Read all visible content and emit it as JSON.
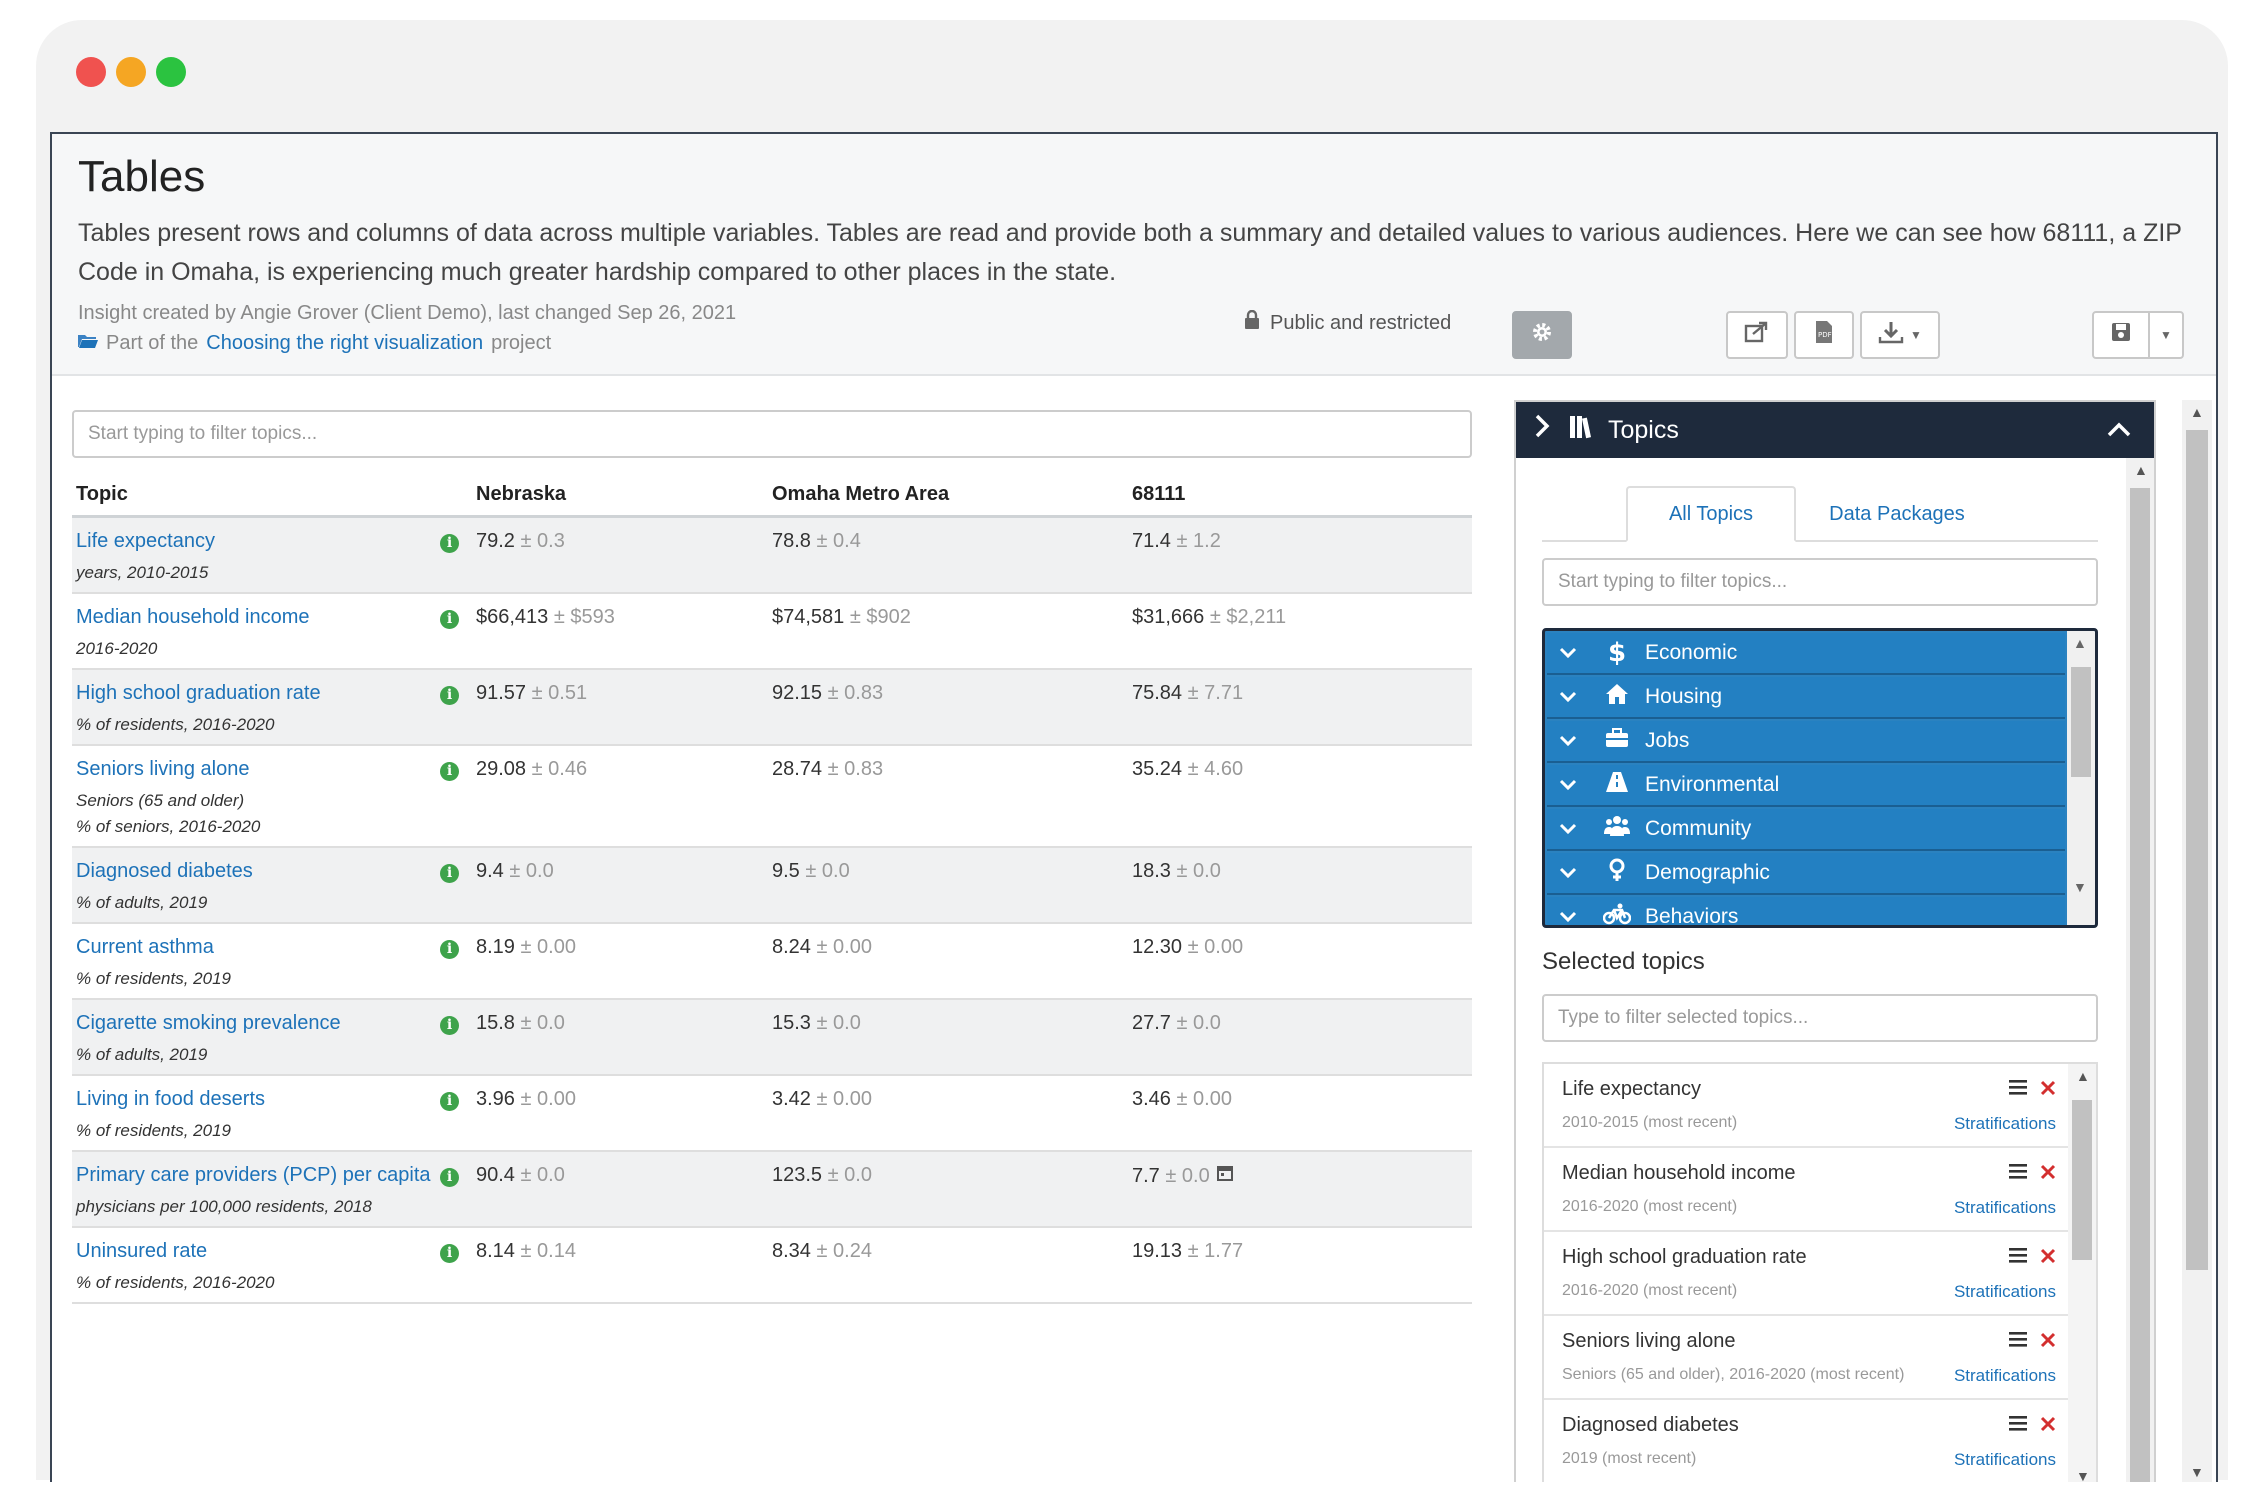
{
  "header": {
    "title": "Tables",
    "description": "Tables present rows and columns of data across multiple variables. Tables are read and provide both a summary and detailed values to various audiences. Here we can see how 68111, a ZIP Code in Omaha, is experiencing much greater hardship compared to other places in the state.",
    "meta": "Insight created by Angie Grover (Client Demo), last changed Sep 26, 2021",
    "project_prefix": "Part of the",
    "project_link": "Choosing the right visualization",
    "project_suffix": "project",
    "privacy": "Public and restricted"
  },
  "table": {
    "filter_placeholder": "Start typing to filter topics...",
    "columns": [
      "Topic",
      "Nebraska",
      "Omaha Metro Area",
      "68111"
    ],
    "rows": [
      {
        "name": "Life expectancy",
        "sub": "years, 2010-2015",
        "sub2": "",
        "v": [
          "79.2",
          "78.8",
          "71.4"
        ],
        "m": [
          "± 0.3",
          "± 0.4",
          "± 1.2"
        ]
      },
      {
        "name": "Median household income",
        "sub": "2016-2020",
        "sub2": "",
        "v": [
          "$66,413",
          "$74,581",
          "$31,666"
        ],
        "m": [
          "± $593",
          "± $902",
          "± $2,211"
        ]
      },
      {
        "name": "High school graduation rate",
        "sub": "% of residents, 2016-2020",
        "sub2": "",
        "v": [
          "91.57",
          "92.15",
          "75.84"
        ],
        "m": [
          "± 0.51",
          "± 0.83",
          "± 7.71"
        ]
      },
      {
        "name": "Seniors living alone",
        "sub": "Seniors (65 and older)",
        "sub2": "% of seniors, 2016-2020",
        "v": [
          "29.08",
          "28.74",
          "35.24"
        ],
        "m": [
          "± 0.46",
          "± 0.83",
          "± 4.60"
        ]
      },
      {
        "name": "Diagnosed diabetes",
        "sub": "% of adults, 2019",
        "sub2": "",
        "v": [
          "9.4",
          "9.5",
          "18.3"
        ],
        "m": [
          "± 0.0",
          "± 0.0",
          "± 0.0"
        ]
      },
      {
        "name": "Current asthma",
        "sub": "% of residents, 2019",
        "sub2": "",
        "v": [
          "8.19",
          "8.24",
          "12.30"
        ],
        "m": [
          "± 0.00",
          "± 0.00",
          "± 0.00"
        ]
      },
      {
        "name": "Cigarette smoking prevalence",
        "sub": "% of adults, 2019",
        "sub2": "",
        "v": [
          "15.8",
          "15.3",
          "27.7"
        ],
        "m": [
          "± 0.0",
          "± 0.0",
          "± 0.0"
        ]
      },
      {
        "name": "Living in food deserts",
        "sub": "% of residents, 2019",
        "sub2": "",
        "v": [
          "3.96",
          "3.42",
          "3.46"
        ],
        "m": [
          "± 0.00",
          "± 0.00",
          "± 0.00"
        ]
      },
      {
        "name": "Primary care providers (PCP) per capita",
        "sub": "physicians per 100,000 residents, 2018",
        "sub2": "",
        "v": [
          "90.4",
          "123.5",
          "7.7"
        ],
        "m": [
          "± 0.0",
          "± 0.0",
          "± 0.0"
        ]
      },
      {
        "name": "Uninsured rate",
        "sub": "% of residents, 2016-2020",
        "sub2": "",
        "v": [
          "8.14",
          "8.34",
          "19.13"
        ],
        "m": [
          "± 0.14",
          "± 0.24",
          "± 1.77"
        ]
      }
    ]
  },
  "panel": {
    "title": "Topics",
    "tabs": [
      "All Topics",
      "Data Packages"
    ],
    "filter_placeholder": "Start typing to filter topics...",
    "categories": [
      {
        "label": "Economic",
        "icon": "dollar-icon"
      },
      {
        "label": "Housing",
        "icon": "house-icon"
      },
      {
        "label": "Jobs",
        "icon": "briefcase-icon"
      },
      {
        "label": "Environmental",
        "icon": "road-icon"
      },
      {
        "label": "Community",
        "icon": "people-icon"
      },
      {
        "label": "Demographic",
        "icon": "person-icon"
      },
      {
        "label": "Behaviors",
        "icon": "bicycle-icon"
      }
    ],
    "selected_title": "Selected topics",
    "selected_filter_placeholder": "Type to filter selected topics...",
    "selected": [
      {
        "name": "Life expectancy",
        "sub": "2010-2015 (most recent)",
        "link": "Stratifications"
      },
      {
        "name": "Median household income",
        "sub": "2016-2020 (most recent)",
        "link": "Stratifications"
      },
      {
        "name": "High school graduation rate",
        "sub": "2016-2020 (most recent)",
        "link": "Stratifications"
      },
      {
        "name": "Seniors living alone",
        "sub": "Seniors (65 and older), 2016-2020 (most recent)",
        "link": "Stratifications"
      },
      {
        "name": "Diagnosed diabetes",
        "sub": "2019 (most recent)",
        "link": "Stratifications"
      }
    ]
  },
  "colors": {
    "accent": "#1d72b8",
    "category": "#2380c2",
    "panel_header": "#1e2a3c",
    "info": "#3ea34b"
  }
}
